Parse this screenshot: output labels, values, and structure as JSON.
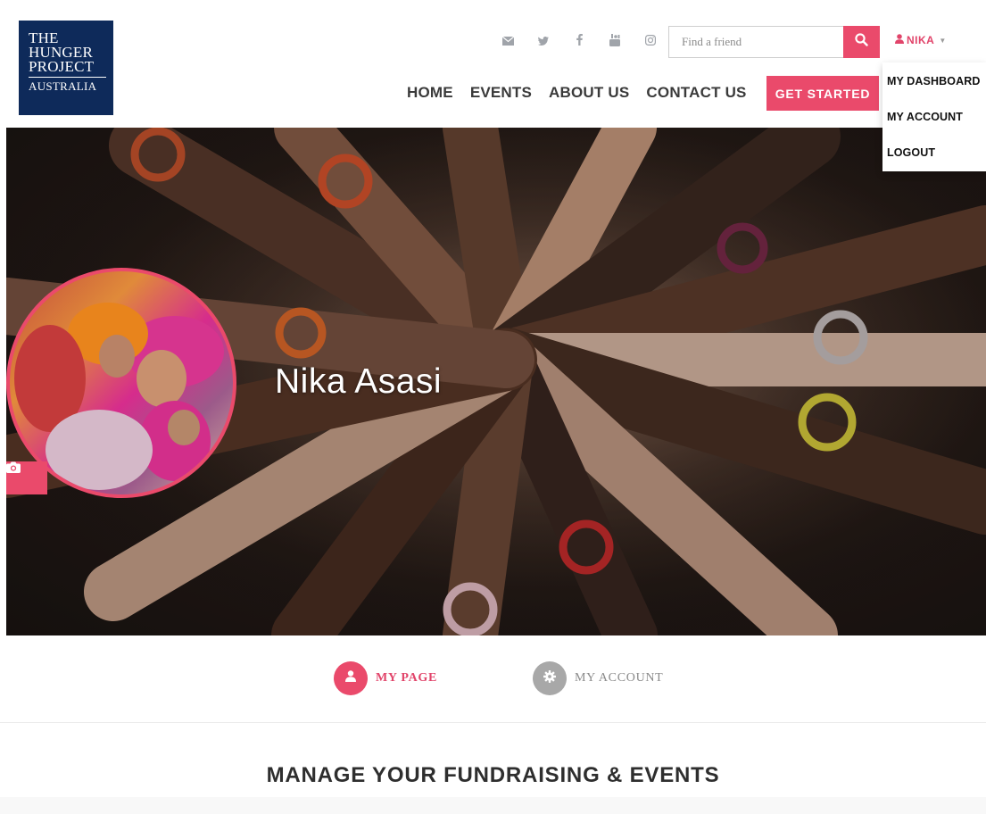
{
  "logo": {
    "line1": "THE",
    "line2": "HUNGER",
    "line3": "PROJECT",
    "line4": "AUSTRALIA"
  },
  "social_icons": [
    "envelope-icon",
    "twitter-icon",
    "facebook-icon",
    "youtube-icon",
    "instagram-icon"
  ],
  "search": {
    "placeholder": "Find a friend",
    "button_icon": "search-icon"
  },
  "user": {
    "name": "NIKA"
  },
  "nav": {
    "items": [
      "HOME",
      "EVENTS",
      "ABOUT US",
      "CONTACT US"
    ],
    "cta": "GET STARTED"
  },
  "dropdown": {
    "items": [
      "MY DASHBOARD",
      "MY ACCOUNT",
      "LOGOUT"
    ]
  },
  "hero": {
    "name": "Nika Asasi"
  },
  "tabs": [
    {
      "label": "MY PAGE",
      "icon": "user-icon"
    },
    {
      "label": "MY ACCOUNT",
      "icon": "gear-icon"
    }
  ],
  "section": {
    "title": "MANAGE YOUR FUNDRAISING & EVENTS"
  },
  "colors": {
    "accent": "#ea4a6b",
    "logo_bg": "#0e2a5a"
  }
}
